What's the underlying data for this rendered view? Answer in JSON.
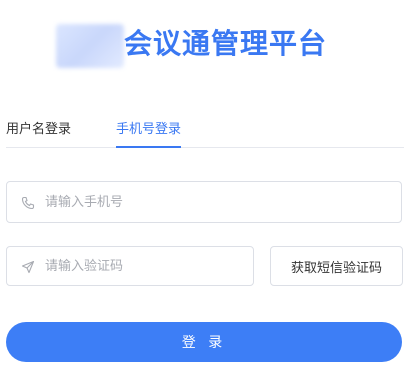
{
  "header": {
    "title": "会议通管理平台"
  },
  "tabs": [
    {
      "label": "用户名登录",
      "active": false
    },
    {
      "label": "手机号登录",
      "active": true
    }
  ],
  "form": {
    "phone": {
      "placeholder": "请输入手机号",
      "value": "",
      "icon": "phone-icon"
    },
    "code": {
      "placeholder": "请输入验证码",
      "value": "",
      "icon": "send-icon"
    },
    "sms_button_label": "获取短信验证码",
    "login_button_label": "登 录"
  },
  "colors": {
    "accent": "#3a78f2",
    "button": "#3d7ef6",
    "border": "#dcdfe6"
  }
}
